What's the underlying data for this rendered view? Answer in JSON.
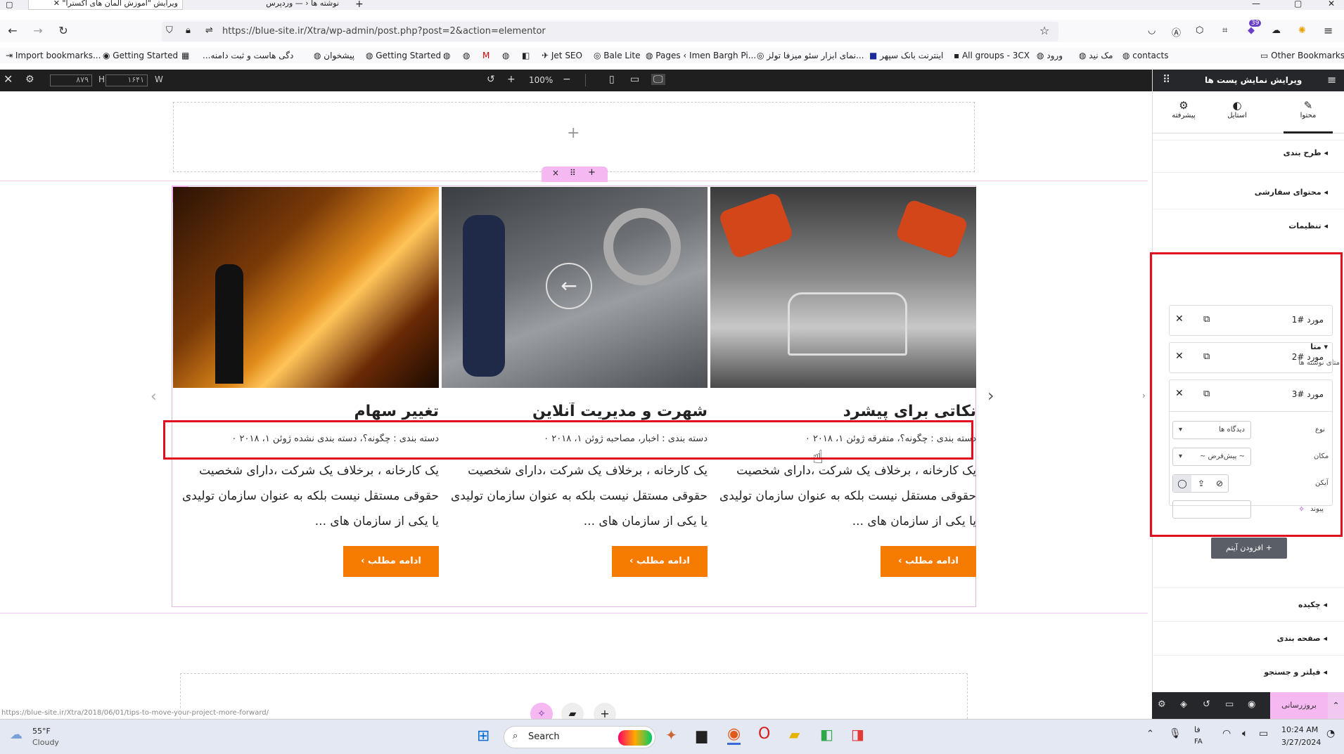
{
  "browser": {
    "tabs": [
      {
        "label": "ویرایش \"آموزش المان های اکسترا\""
      },
      {
        "label": "نوشته ها ‹ — وردپرس"
      }
    ],
    "url": "https://blue-site.ir/Xtra/wp-admin/post.php?post=2&action=elementor",
    "bookmarks": [
      "Import bookmarks...",
      "Getting Started",
      "دگی هاست و ثبت دامنه...",
      "پیشخوان",
      "Getting Started",
      "Jet SEO",
      "Bale Lite",
      "Pages ‹ Imen Bargh Pi...",
      "نمای ابزار سئو میزفا تولز...",
      "اینترنت بانک سپهر",
      "All groups - 3CX",
      "ورود",
      "مک نید",
      "contacts",
      "Other Bookmarks"
    ],
    "extension_badge": "39"
  },
  "editor_toolbar": {
    "width_value": "۸۷۹",
    "height_value": "۱۶۴۱",
    "h_label": "H",
    "w_label": "W",
    "zoom": "100%"
  },
  "section_toolbar": {
    "close": "×",
    "move": "⠿",
    "add": "+"
  },
  "posts": [
    {
      "title": "نکاتی برای پیشرد",
      "meta": "دسته بندی : چگونه؟، متفرقه  ژوئن ۱، ۲۰۱۸  ۰",
      "excerpt": "یک کارخانه ، برخلاف یک شرکت ،دارای شخصیت حقوقی مستقل نیست بلکه به عنوان سازمان تولیدی یا یکی از سازمان های ...",
      "button": "ادامه مطلب"
    },
    {
      "title": "شهرت و مدیریت آنلاین",
      "meta": "دسته بندی : اخبار، مصاحبه  ژوئن ۱، ۲۰۱۸  ۰",
      "excerpt": "یک کارخانه ، برخلاف یک شرکت ،دارای شخصیت حقوقی مستقل نیست بلکه به عنوان سازمان تولیدی یا یکی از سازمان های ...",
      "button": "ادامه مطلب"
    },
    {
      "title": "تغییر سهام",
      "meta": "دسته بندی : چگونه؟، دسته بندی نشده  ژوئن ۱، ۲۰۱۸  ۰",
      "excerpt": "یک کارخانه ، برخلاف یک شرکت ،دارای شخصیت حقوقی مستقل نیست بلکه به عنوان سازمان تولیدی یا یکی از سازمان های ...",
      "button": "ادامه مطلب"
    }
  ],
  "panel": {
    "title": "ویرایش نمایش پست ها",
    "tabs": [
      {
        "label": "محتوا"
      },
      {
        "label": "استایل"
      },
      {
        "label": "پیشرفته"
      }
    ],
    "sections": [
      "طرح بندی",
      "محتوای سفارشی",
      "تنظیمات",
      "متا",
      "چکیده",
      "صفحه بندی",
      "فیلتر و جستجو"
    ],
    "meta_caption": "متای نوشته ها",
    "items": [
      "مورد #1",
      "مورد #2",
      "مورد #3"
    ],
    "type_label": "نوع",
    "type_value": "دیدگاه ها",
    "position_label": "مکان",
    "position_value": "~ پیش‌فرض ~",
    "icon_label": "آیکن",
    "link_label": "پیوند",
    "add_item": "افزودن آیتم",
    "update_button": "بروزرسانی"
  },
  "status_url": "https://blue-site.ir/Xtra/2018/06/01/tips-to-move-your-project-more-forward/",
  "taskbar": {
    "weather_temp": "55°F",
    "weather_desc": "Cloudy",
    "search": "Search",
    "lang": "فا",
    "lang2": "FA",
    "time": "10:24 AM",
    "date": "3/27/2024"
  },
  "colors": {
    "accent": "#f57c00",
    "highlight": "#e01020",
    "section_pink": "#f5b8f0"
  }
}
